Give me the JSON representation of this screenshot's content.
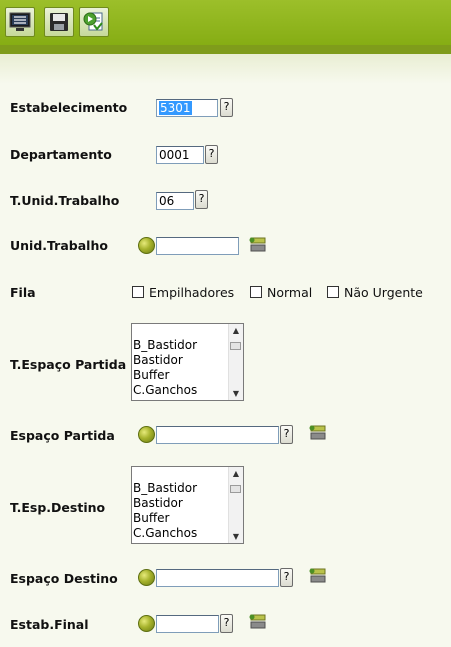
{
  "toolbar": {
    "icons": [
      "monitor-menu-icon",
      "save-disk-icon",
      "execute-document-icon"
    ]
  },
  "form": {
    "estabelecimento": {
      "label": "Estabelecimento",
      "value": "5301",
      "help": "?"
    },
    "departamento": {
      "label": "Departamento",
      "value": "0001",
      "help": "?"
    },
    "t_unid_trabalho": {
      "label": "T.Unid.Trabalho",
      "value": "06",
      "help": "?"
    },
    "unid_trabalho": {
      "label": "Unid.Trabalho",
      "value": ""
    },
    "fila": {
      "label": "Fila",
      "options": [
        {
          "label": "Empilhadores",
          "checked": false
        },
        {
          "label": "Normal",
          "checked": false
        },
        {
          "label": "Não Urgente",
          "checked": false
        }
      ]
    },
    "t_espaco_partida": {
      "label": "T.Espaço Partida",
      "items": [
        "B_Bastidor",
        "Bastidor",
        "Buffer",
        "C.Ganchos"
      ]
    },
    "espaco_partida": {
      "label": "Espaço Partida",
      "value": "",
      "help": "?"
    },
    "t_esp_destino": {
      "label": "T.Esp.Destino",
      "items": [
        "B_Bastidor",
        "Bastidor",
        "Buffer",
        "C.Ganchos"
      ]
    },
    "espaco_destino": {
      "label": "Espaço Destino",
      "value": "",
      "help": "?"
    },
    "estab_final": {
      "label": "Estab.Final",
      "value": "",
      "help": "?"
    }
  }
}
